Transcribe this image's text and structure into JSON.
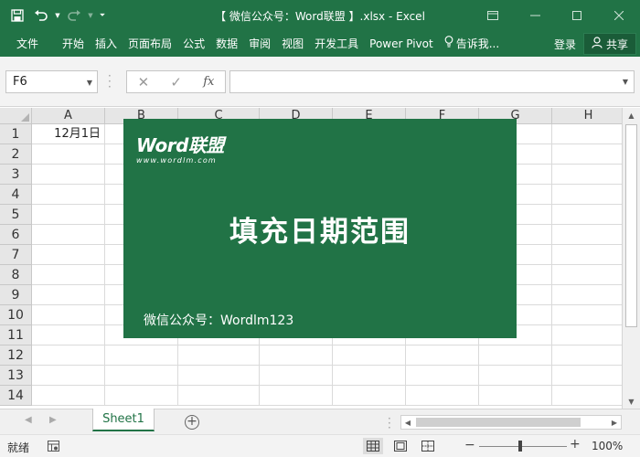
{
  "app": {
    "title": "【 微信公众号：Word联盟 】.xlsx  -  Excel"
  },
  "ribbon": {
    "tabs": [
      "文件",
      "开始",
      "插入",
      "页面布局",
      "公式",
      "数据",
      "审阅",
      "视图",
      "开发工具",
      "Power Pivot"
    ],
    "tell_me": "告诉我...",
    "sign_in": "登录",
    "share": "共享"
  },
  "formula_bar": {
    "name_box": "F6",
    "formula": ""
  },
  "grid": {
    "columns": [
      "A",
      "B",
      "C",
      "D",
      "E",
      "F",
      "G",
      "H"
    ],
    "rows": [
      "1",
      "2",
      "3",
      "4",
      "5",
      "6",
      "7",
      "8",
      "9",
      "10",
      "11",
      "12",
      "13",
      "14"
    ],
    "cells": {
      "A1": "12月1日"
    }
  },
  "banner": {
    "logo": "Word联盟",
    "logo_url": "www.wordlm.com",
    "heading": "填充日期范围",
    "footer": "微信公众号：Wordlm123",
    "color": "#217346"
  },
  "sheets": {
    "tabs": [
      "Sheet1"
    ],
    "active": "Sheet1"
  },
  "status": {
    "text": "就绪",
    "zoom": "100%"
  },
  "theme": {
    "accent": "#217346"
  }
}
